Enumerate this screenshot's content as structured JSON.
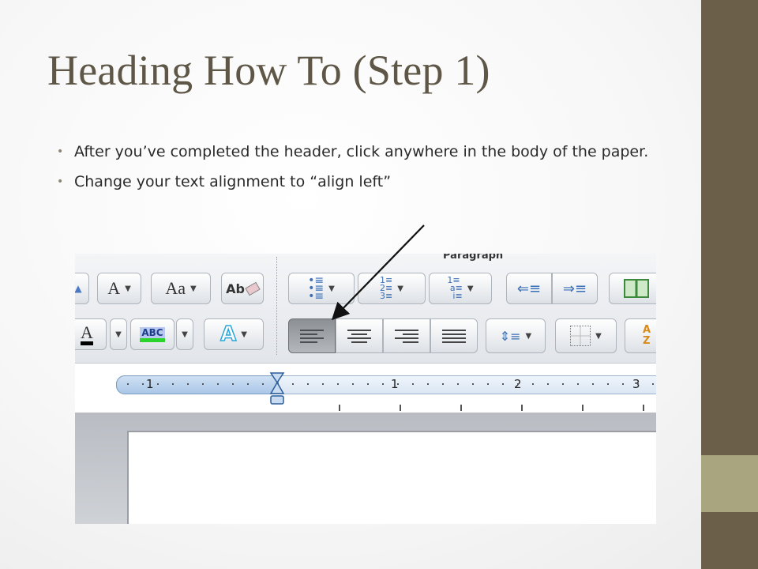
{
  "slide": {
    "title": "Heading How To (Step 1)",
    "bullets": [
      "After you’ve completed the header, click anywhere in the body of the paper.",
      "Change your text alignment to “align left”"
    ]
  },
  "screenshot": {
    "group_label": "Paragraph",
    "font_buttons": {
      "font_size": "A",
      "change_case": "Aa",
      "clear_format": "Ab",
      "font_color": "A",
      "highlight": "ABC",
      "text_effects": "A"
    },
    "alignment": [
      "align-left",
      "align-center",
      "align-right",
      "justify"
    ],
    "active_alignment": "align-left",
    "sort_label": "A Z",
    "ruler_numbers": [
      "1",
      "1",
      "2",
      "3"
    ]
  },
  "colors": {
    "title": "#5e5646",
    "sidebar": "#6b5f49",
    "sidebar_accent": "#a8a57f"
  }
}
